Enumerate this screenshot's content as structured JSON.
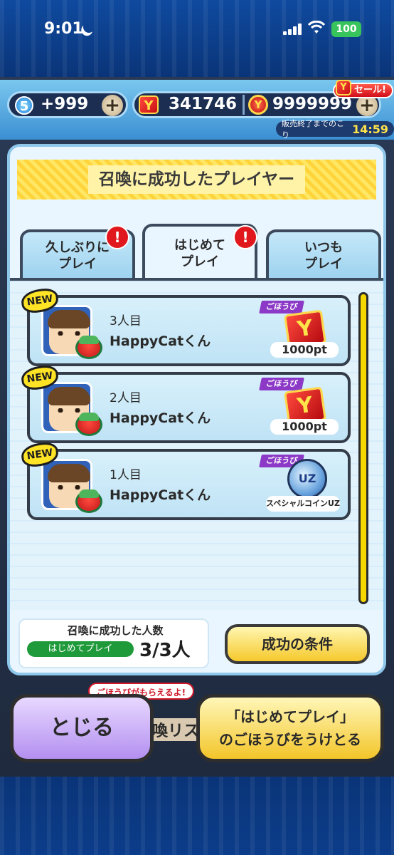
{
  "status_bar": {
    "time": "9:01",
    "battery": "100"
  },
  "currency": {
    "orb_level": "5",
    "stamina": "+999",
    "points": "341746",
    "coins": "9999999",
    "sale_label": "セール!",
    "sale_end_label": "販売終了までのこり",
    "sale_timer": "14:59",
    "plus": "+"
  },
  "panel": {
    "title": "召喚に成功したプレイヤー",
    "tabs": [
      {
        "line1": "久しぶりに",
        "line2": "プレイ",
        "alert": "!"
      },
      {
        "line1": "はじめて",
        "line2": "プレイ",
        "alert": "!"
      },
      {
        "line1": "いつも",
        "line2": "プレイ"
      }
    ],
    "rows": [
      {
        "badge": "NEW",
        "count": "3人目",
        "name": "HappyCatくん",
        "reward_label": "ごほうび",
        "reward_icon": "Y",
        "reward_amount": "1000pt"
      },
      {
        "badge": "NEW",
        "count": "2人目",
        "name": "HappyCatくん",
        "reward_label": "ごほうび",
        "reward_icon": "Y",
        "reward_amount": "1000pt"
      },
      {
        "badge": "NEW",
        "count": "1人目",
        "name": "HappyCatくん",
        "reward_label": "ごほうび",
        "reward_icon": "UZ",
        "reward_amount": "スペシャルコインUZ"
      }
    ],
    "footer": {
      "title": "召喚に成功した人数",
      "tag": "はじめてプレイ",
      "count": "3/3人"
    },
    "conditions_button": "成功の条件"
  },
  "background": {
    "ribbon": "ごほうびがもらえるよ!",
    "list_text": "喚リス"
  },
  "buttons": {
    "close": "とじる",
    "receive_line1": "「はじめてプレイ」",
    "receive_line2": "のごほうびをうけとる"
  },
  "colors": {
    "accent_yellow": "#f6c92c",
    "alert_red": "#e0171d",
    "panel_bg": "#eaf6ff",
    "close_purple": "#b38ff0"
  }
}
